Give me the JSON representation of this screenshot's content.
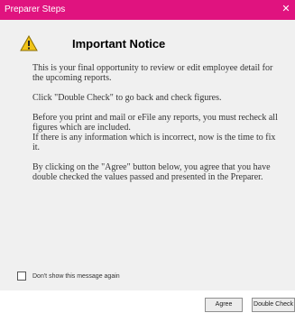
{
  "window": {
    "title": "Preparer Steps",
    "close_glyph": "✕"
  },
  "notice": {
    "icon": "warning-icon",
    "icon_color": "#f0c419",
    "heading": "Important Notice",
    "paragraphs": [
      "This is your final opportunity to review or edit employee detail for the upcoming reports.",
      "Click \"Double Check\" to go back and check figures.",
      "Before you print and mail or eFile any reports, you must recheck all figures which are included.",
      "If there is any information which is incorrect, now is the time to fix it.",
      "By clicking on the \"Agree\" button below, you agree that you have double checked the values passed and presented in the Preparer."
    ]
  },
  "dont_show": {
    "label": "Don't show this message again",
    "checked": false
  },
  "buttons": {
    "agree": "Agree",
    "double_check": "Double Check"
  },
  "colors": {
    "titlebar": "#e0137f",
    "content_bg": "#f0f0f0"
  }
}
